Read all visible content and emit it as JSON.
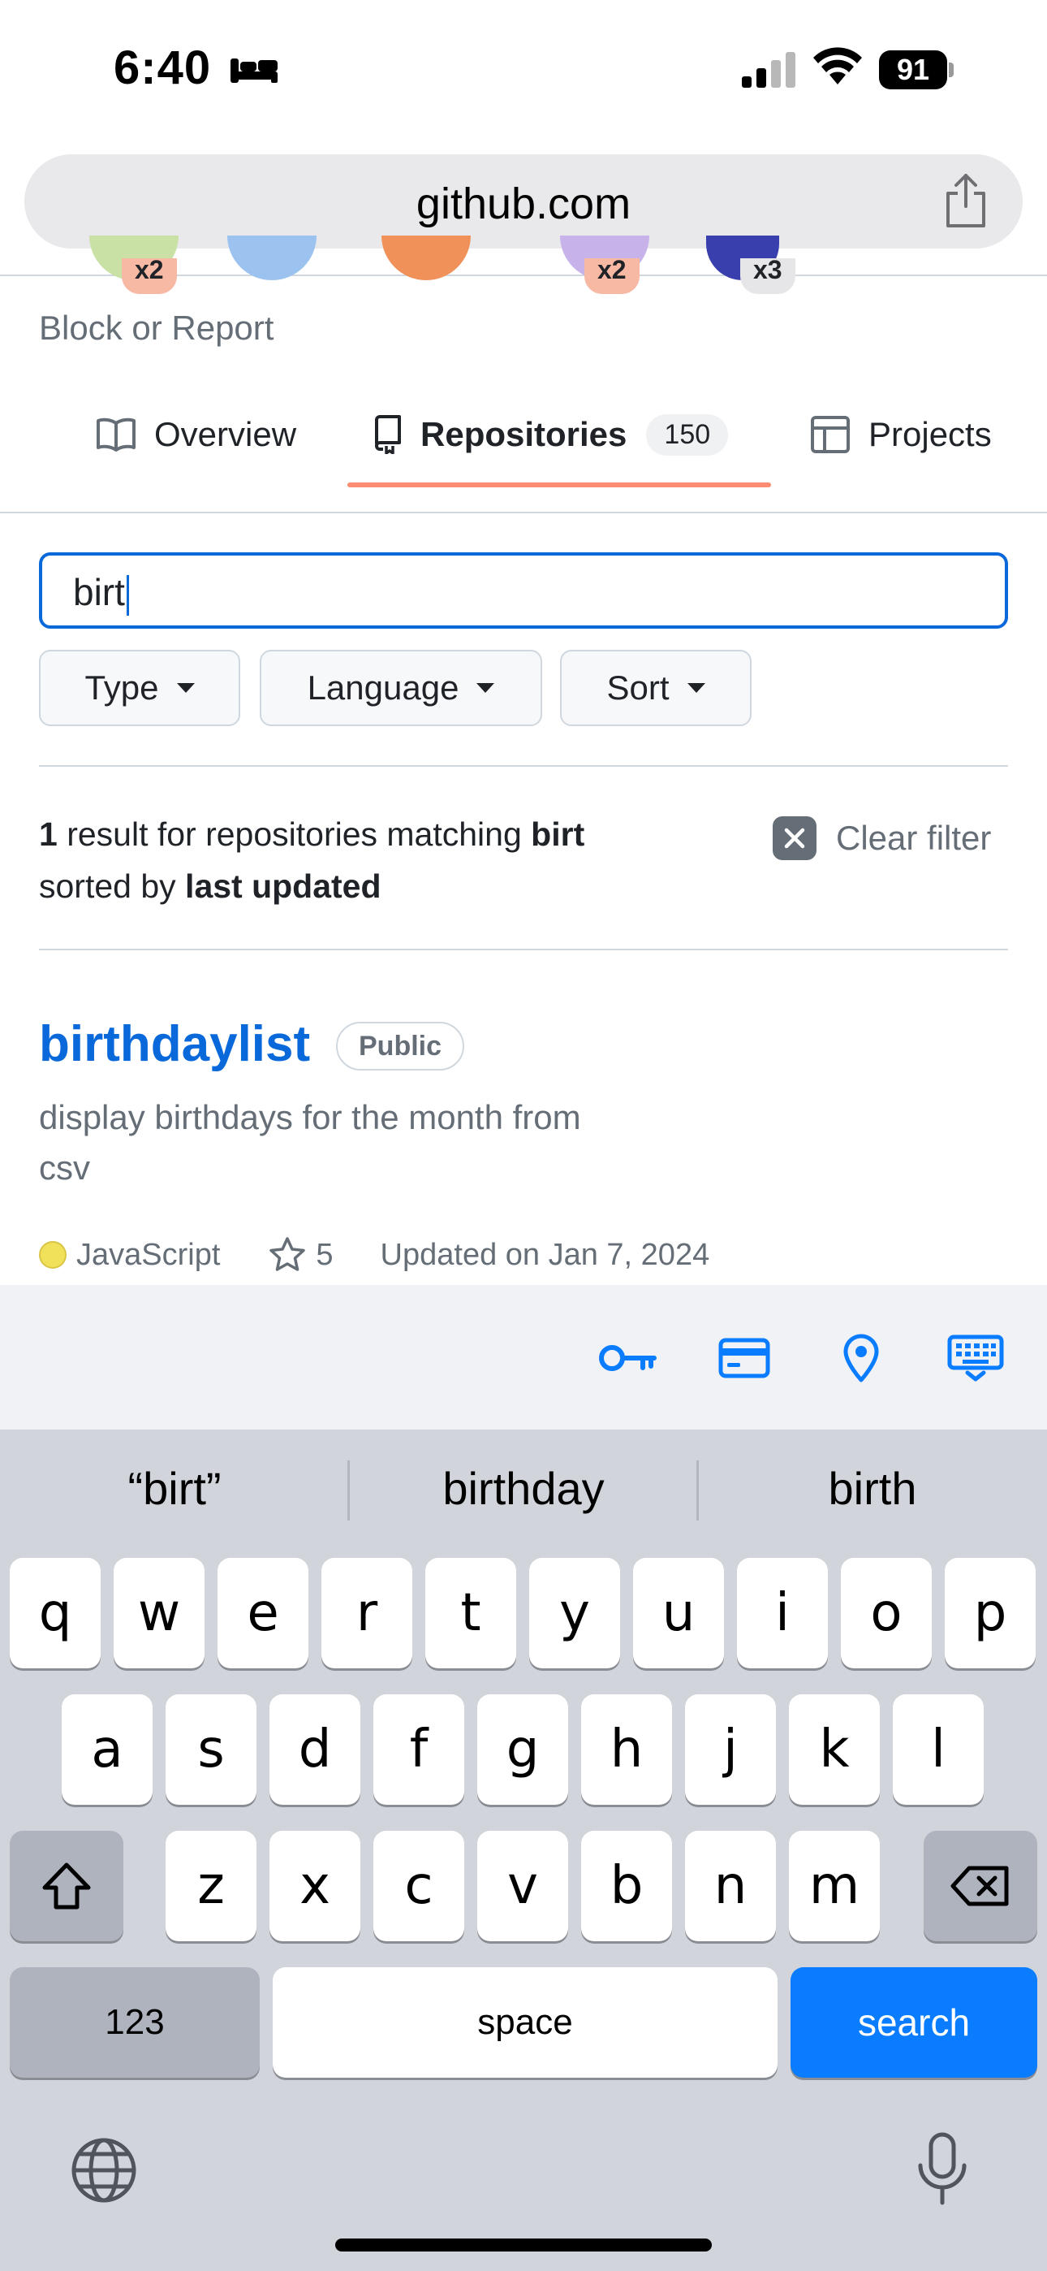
{
  "status_bar": {
    "time": "6:40",
    "battery": "91"
  },
  "browser": {
    "address": "github.com"
  },
  "profile": {
    "block_report": "Block or Report",
    "badges": [
      "x2",
      "x2",
      "x3"
    ]
  },
  "tabs": [
    {
      "label": "Overview"
    },
    {
      "label": "Repositories",
      "count": "150"
    },
    {
      "label": "Projects"
    }
  ],
  "search": {
    "value": "birt"
  },
  "filters": [
    {
      "label": "Type"
    },
    {
      "label": "Language"
    },
    {
      "label": "Sort"
    }
  ],
  "results": {
    "count": "1",
    "text_mid": " result for repositories matching ",
    "query": "birt",
    "sorted_prefix": "sorted by ",
    "sort_key": "last updated",
    "clear_filter": "Clear filter"
  },
  "repo": {
    "name": "birthdaylist",
    "visibility": "Public",
    "description": "display birthdays for the month from csv",
    "language": "JavaScript",
    "language_color": "#f1e05a",
    "stars": "5",
    "updated": "Updated on Jan 7, 2024"
  },
  "autofill_icons": [
    "key-icon",
    "credit-card-icon",
    "location-pin-icon",
    "keyboard-dismiss-icon"
  ],
  "keyboard": {
    "suggestions": [
      "“birt”",
      "birthday",
      "birth"
    ],
    "row1": [
      "q",
      "w",
      "e",
      "r",
      "t",
      "y",
      "u",
      "i",
      "o",
      "p"
    ],
    "row2": [
      "a",
      "s",
      "d",
      "f",
      "g",
      "h",
      "j",
      "k",
      "l"
    ],
    "row3": [
      "z",
      "x",
      "c",
      "v",
      "b",
      "n",
      "m"
    ],
    "numbers_key": "123",
    "space_key": "space",
    "search_key": "search"
  },
  "colors": {
    "accent": "#0969da",
    "tab_underline": "#fd8c73",
    "search_key": "#0a7cff"
  }
}
